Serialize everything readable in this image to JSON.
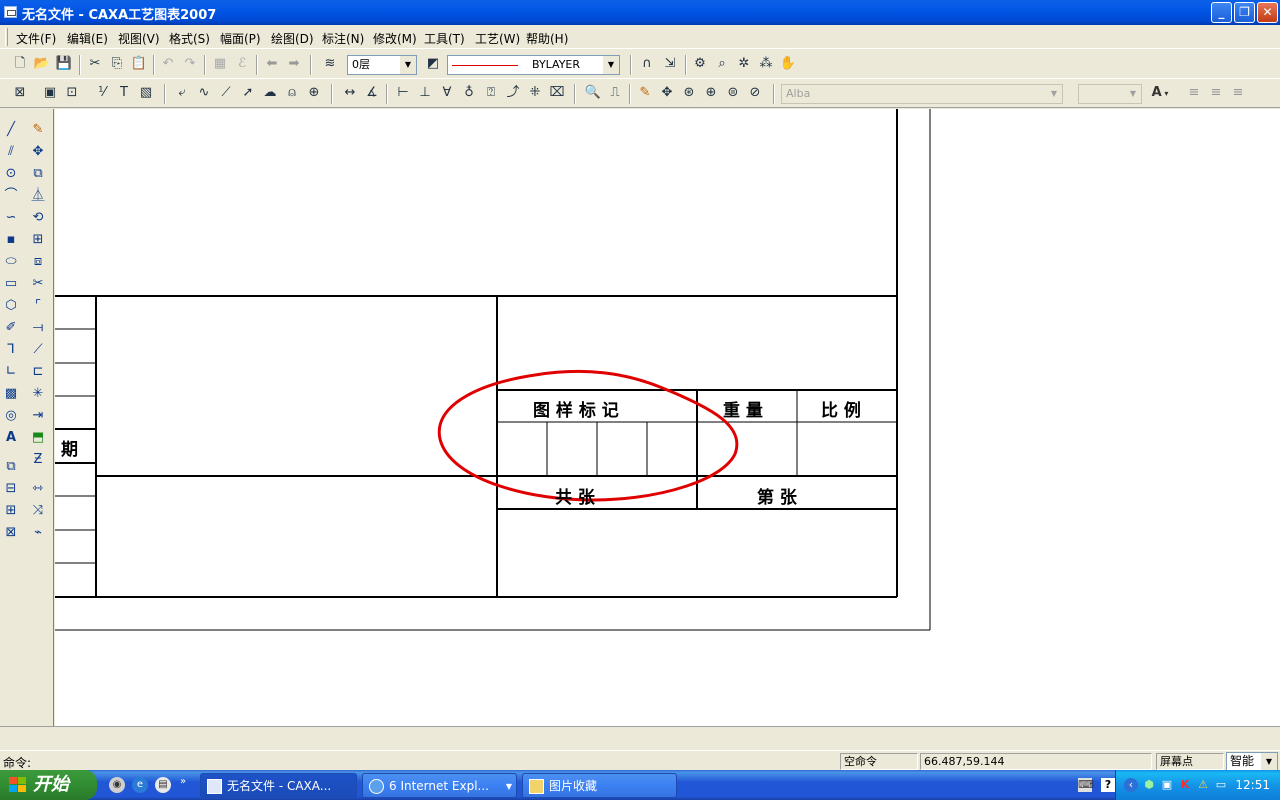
{
  "window": {
    "title": "无名文件 - CAXA工艺图表2007",
    "controls": [
      "minimize",
      "restore",
      "close"
    ]
  },
  "menu": [
    {
      "label": "文件(F)"
    },
    {
      "label": "编辑(E)"
    },
    {
      "label": "视图(V)"
    },
    {
      "label": "格式(S)"
    },
    {
      "label": "幅面(P)"
    },
    {
      "label": "绘图(D)"
    },
    {
      "label": "标注(N)"
    },
    {
      "label": "修改(M)"
    },
    {
      "label": "工具(T)"
    },
    {
      "label": "工艺(W)"
    },
    {
      "label": "帮助(H)"
    }
  ],
  "toolbar": {
    "layer_value": "0层",
    "linetype_value": "BYLAYER",
    "font_value": "Alba",
    "size_value": "",
    "text_color_label": "A"
  },
  "drawing": {
    "row_label_partial": "期",
    "title_block": {
      "mark_label": "图 样 标 记",
      "weight_label": "重 量",
      "scale_label": "比 例",
      "total_label": "共 张",
      "sheet_label": "第 张"
    },
    "annotation_color": "#e00000"
  },
  "status": {
    "command_label": "命令:",
    "command_state": "空命令",
    "coordinates": "66.487,59.144",
    "snap_label": "屏幕点",
    "mode_value": "智能"
  },
  "taskbar": {
    "start_label": "开始",
    "tasks": [
      {
        "label": "无名文件 - CAXA..."
      },
      {
        "label": "6 Internet Expl..."
      },
      {
        "label": "图片收藏"
      }
    ],
    "clock": "12:51"
  }
}
